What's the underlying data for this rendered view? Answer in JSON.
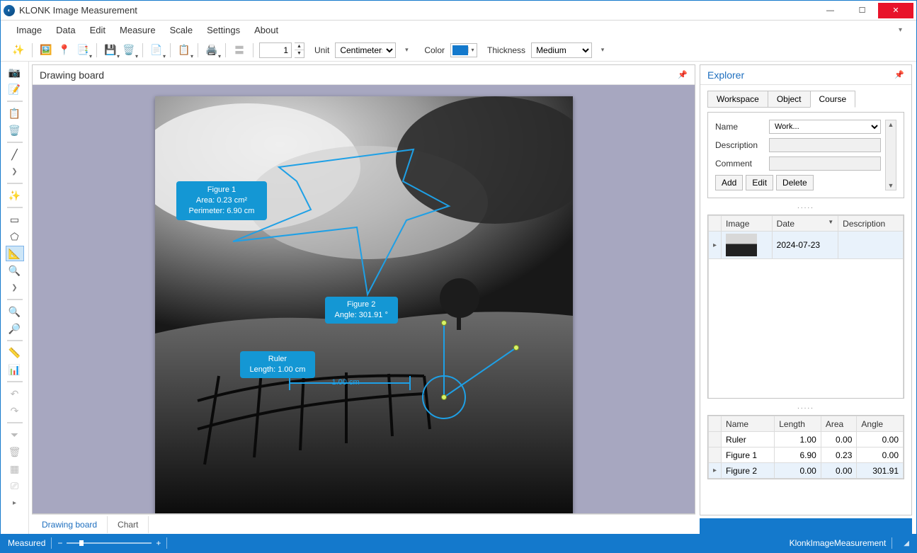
{
  "app": {
    "title": "KLONK Image Measurement"
  },
  "menu": {
    "items": [
      "Image",
      "Data",
      "Edit",
      "Measure",
      "Scale",
      "Settings",
      "About"
    ]
  },
  "toolbar": {
    "count_value": "1",
    "unit_label": "Unit",
    "unit_value": "Centimeters",
    "color_label": "Color",
    "color_value": "#1479cc",
    "thickness_label": "Thickness",
    "thickness_value": "Medium"
  },
  "drawing": {
    "panel_title": "Drawing board",
    "figure1": {
      "title": "Figure 1",
      "area": "Area: 0.23 cm²",
      "perimeter": "Perimeter: 6.90 cm"
    },
    "figure2": {
      "title": "Figure 2",
      "angle": "Angle: 301.91 °"
    },
    "ruler": {
      "title": "Ruler",
      "length": "Length: 1.00 cm",
      "inline": "1.00 cm"
    },
    "tabs": {
      "board": "Drawing board",
      "chart": "Chart"
    }
  },
  "explorer": {
    "title": "Explorer",
    "tabs": {
      "workspace": "Workspace",
      "object": "Object",
      "course": "Course"
    },
    "course": {
      "name_label": "Name",
      "name_value": "Work...",
      "desc_label": "Description",
      "comment_label": "Comment",
      "add": "Add",
      "edit": "Edit",
      "delete": "Delete"
    },
    "dots": ".....",
    "grid1": {
      "headers": {
        "image": "Image",
        "date": "Date",
        "desc": "Description"
      },
      "rows": [
        {
          "date": "2024-07-23",
          "desc": ""
        }
      ]
    },
    "grid2": {
      "headers": {
        "name": "Name",
        "length": "Length",
        "area": "Area",
        "angle": "Angle"
      },
      "rows": [
        {
          "name": "Ruler",
          "length": "1.00",
          "area": "0.00",
          "angle": "0.00"
        },
        {
          "name": "Figure 1",
          "length": "6.90",
          "area": "0.23",
          "angle": "0.00"
        },
        {
          "name": "Figure 2",
          "length": "0.00",
          "area": "0.00",
          "angle": "301.91"
        }
      ]
    }
  },
  "status": {
    "measured": "Measured",
    "minus": "−",
    "plus": "+",
    "brand": "KlonkImageMeasurement"
  }
}
